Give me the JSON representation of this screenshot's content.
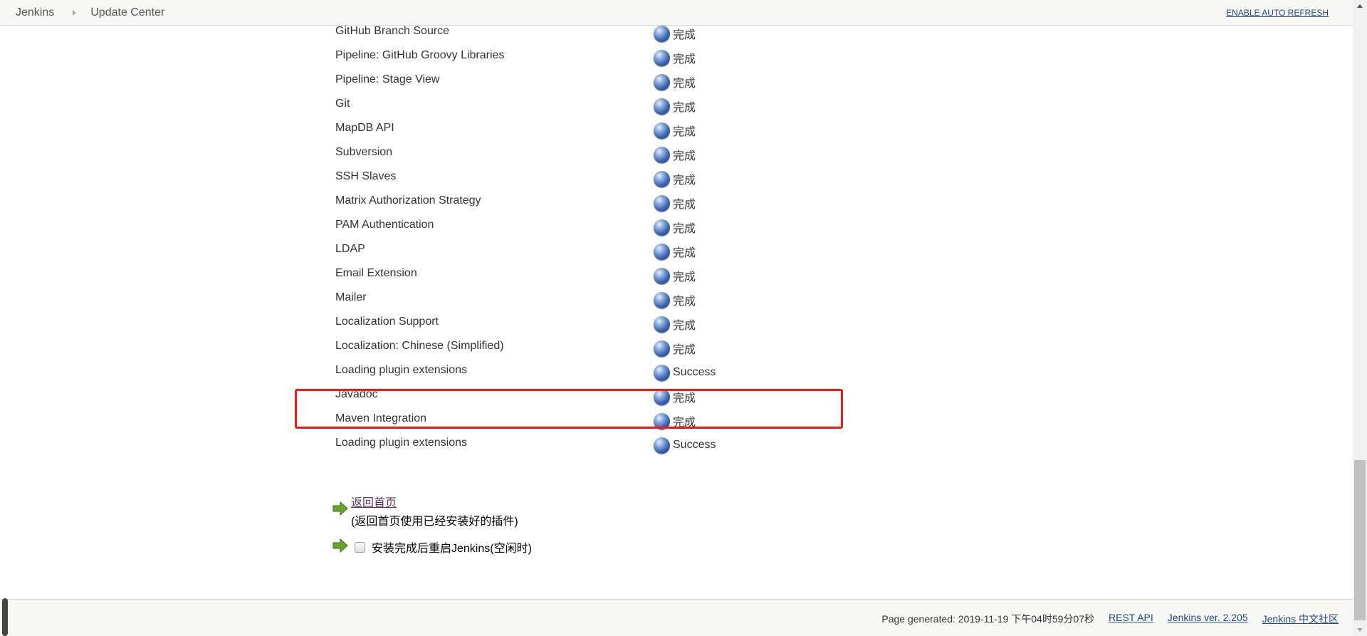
{
  "header": {
    "breadcrumbs": [
      "Jenkins",
      "Update Center"
    ],
    "auto_refresh": "ENABLE AUTO REFRESH"
  },
  "plugins": [
    {
      "name": "GitHub Branch Source",
      "status": "完成"
    },
    {
      "name": "Pipeline: GitHub Groovy Libraries",
      "status": "完成"
    },
    {
      "name": "Pipeline: Stage View",
      "status": "完成"
    },
    {
      "name": "Git",
      "status": "完成"
    },
    {
      "name": "MapDB API",
      "status": "完成"
    },
    {
      "name": "Subversion",
      "status": "完成"
    },
    {
      "name": "SSH Slaves",
      "status": "完成"
    },
    {
      "name": "Matrix Authorization Strategy",
      "status": "完成"
    },
    {
      "name": "PAM Authentication",
      "status": "完成"
    },
    {
      "name": "LDAP",
      "status": "完成"
    },
    {
      "name": "Email Extension",
      "status": "完成"
    },
    {
      "name": "Mailer",
      "status": "完成"
    },
    {
      "name": "Localization Support",
      "status": "完成"
    },
    {
      "name": "Localization: Chinese (Simplified)",
      "status": "完成"
    },
    {
      "name": "Loading plugin extensions",
      "status": "Success"
    },
    {
      "name": "Javadoc",
      "status": "完成"
    },
    {
      "name": "Maven Integration",
      "status": "完成"
    },
    {
      "name": "Loading plugin extensions",
      "status": "Success"
    }
  ],
  "actions": {
    "home_link": "返回首页",
    "home_desc": "(返回首页使用已经安装好的插件)",
    "restart_label": "安装完成后重启Jenkins(空闲时)",
    "restart_checked": false
  },
  "footer": {
    "generated": "Page generated: 2019-11-19 下午04时59分07秒",
    "rest_api": "REST API",
    "version": "Jenkins ver. 2.205",
    "community": "Jenkins 中文社区"
  },
  "colors": {
    "highlight_box": "#f01a1a",
    "status_ball": "#3a64b0",
    "arrow": "#6aa62e"
  }
}
